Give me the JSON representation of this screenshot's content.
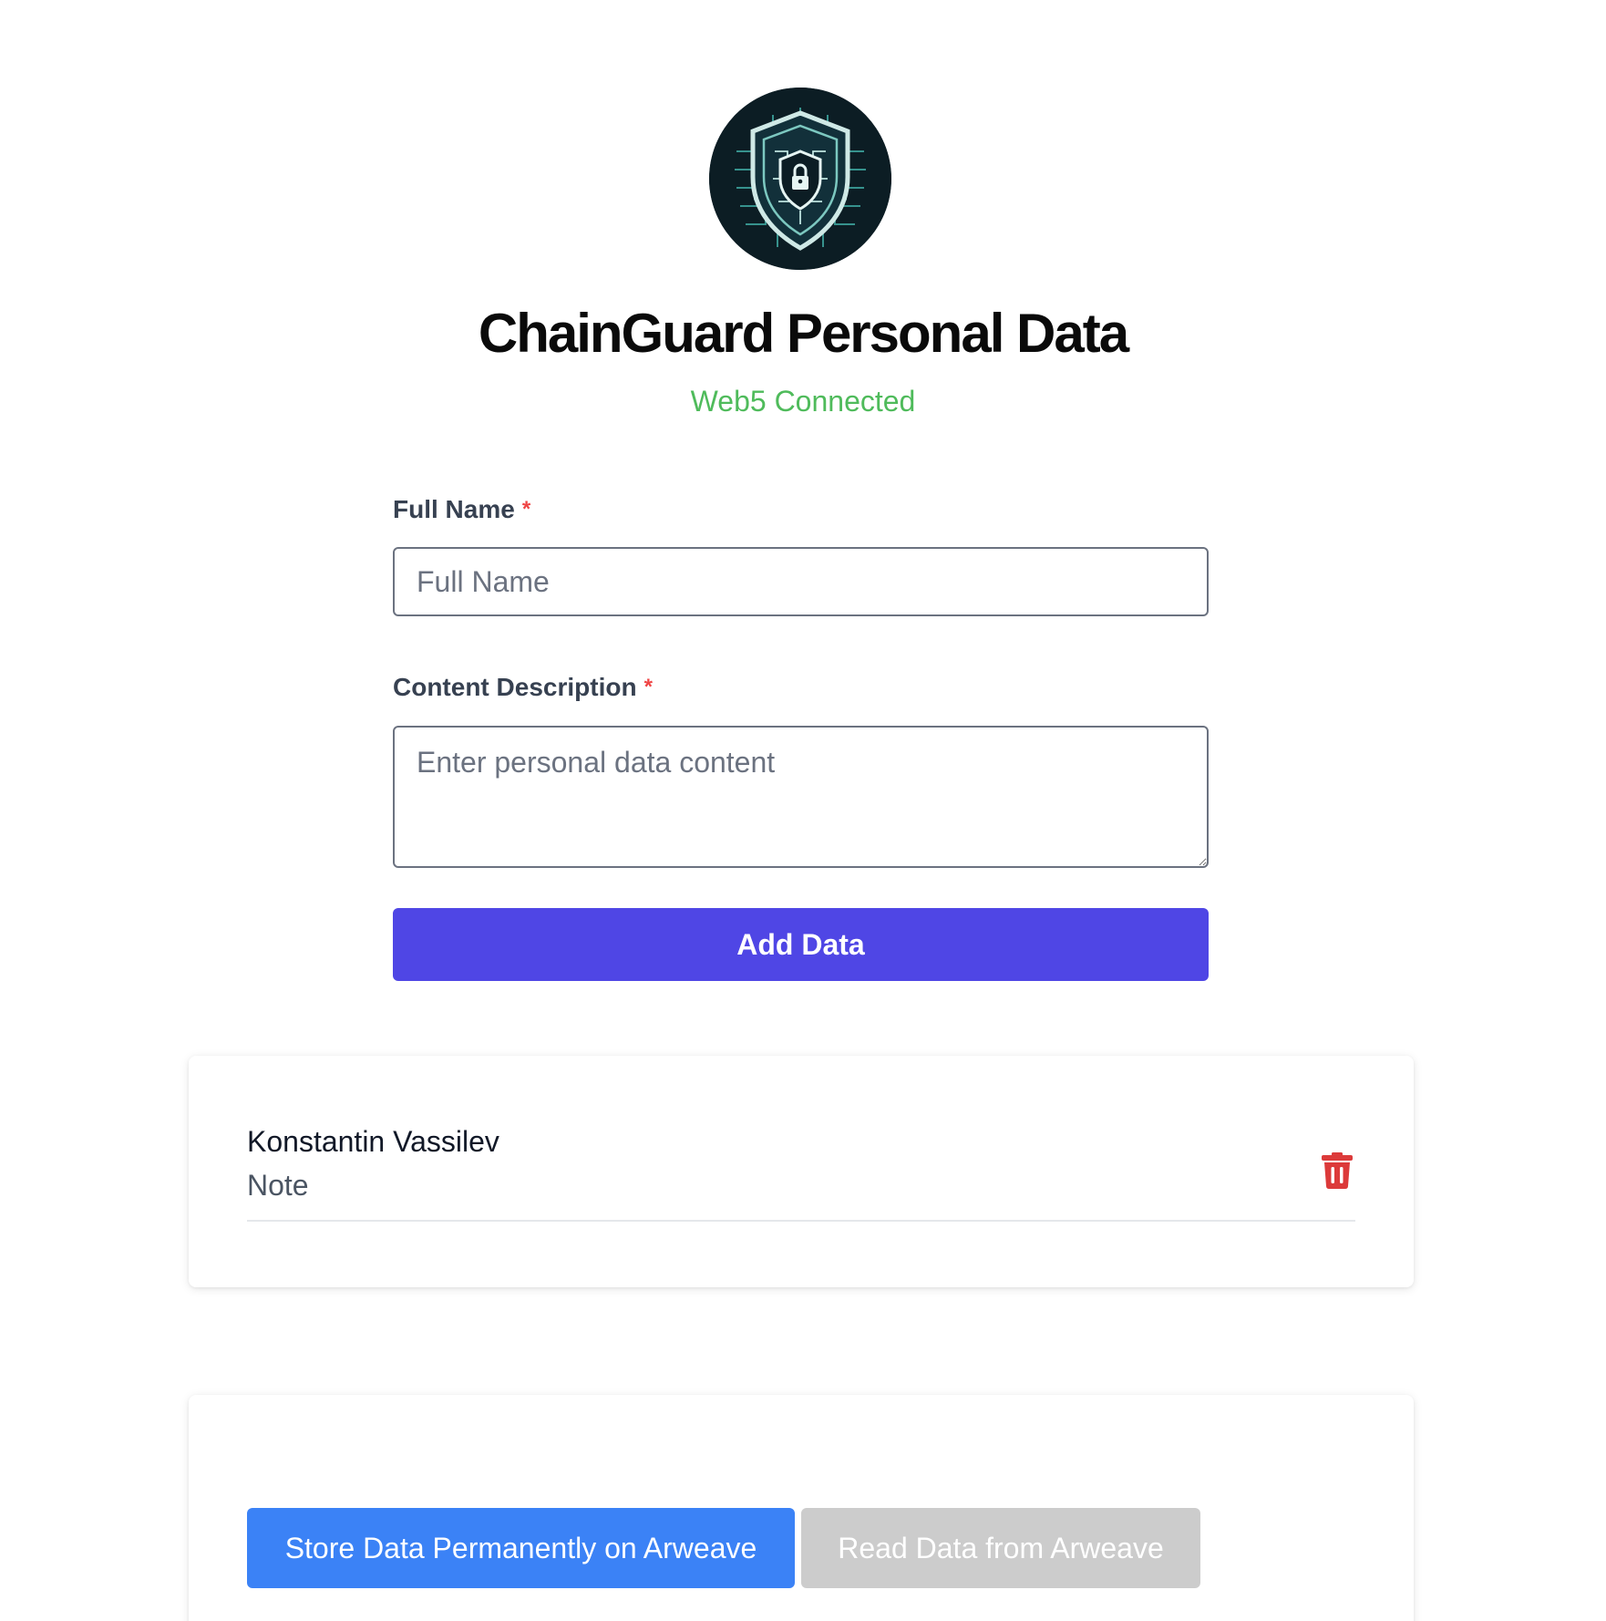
{
  "header": {
    "logo_icon": "shield-circuit-lock-icon",
    "title": "ChainGuard Personal Data",
    "status": "Web5 Connected",
    "status_color": "#4fbb5b"
  },
  "form": {
    "full_name": {
      "label": "Full Name",
      "required_marker": "*",
      "placeholder": "Full Name",
      "value": ""
    },
    "content_description": {
      "label": "Content Description",
      "required_marker": "*",
      "placeholder": "Enter personal data content",
      "value": ""
    },
    "add_button": {
      "label": "Add Data",
      "color": "#4f46e5"
    }
  },
  "entries": [
    {
      "name": "Konstantin Vassilev",
      "description": "Note",
      "delete_icon": "trash-icon",
      "delete_color": "#dc3a3a"
    }
  ],
  "actions": {
    "store_button": {
      "label": "Store Data Permanently on Arweave",
      "color": "#3b82f6"
    },
    "read_button": {
      "label": "Read Data from Arweave",
      "color": "#cccccc",
      "disabled": true
    }
  }
}
